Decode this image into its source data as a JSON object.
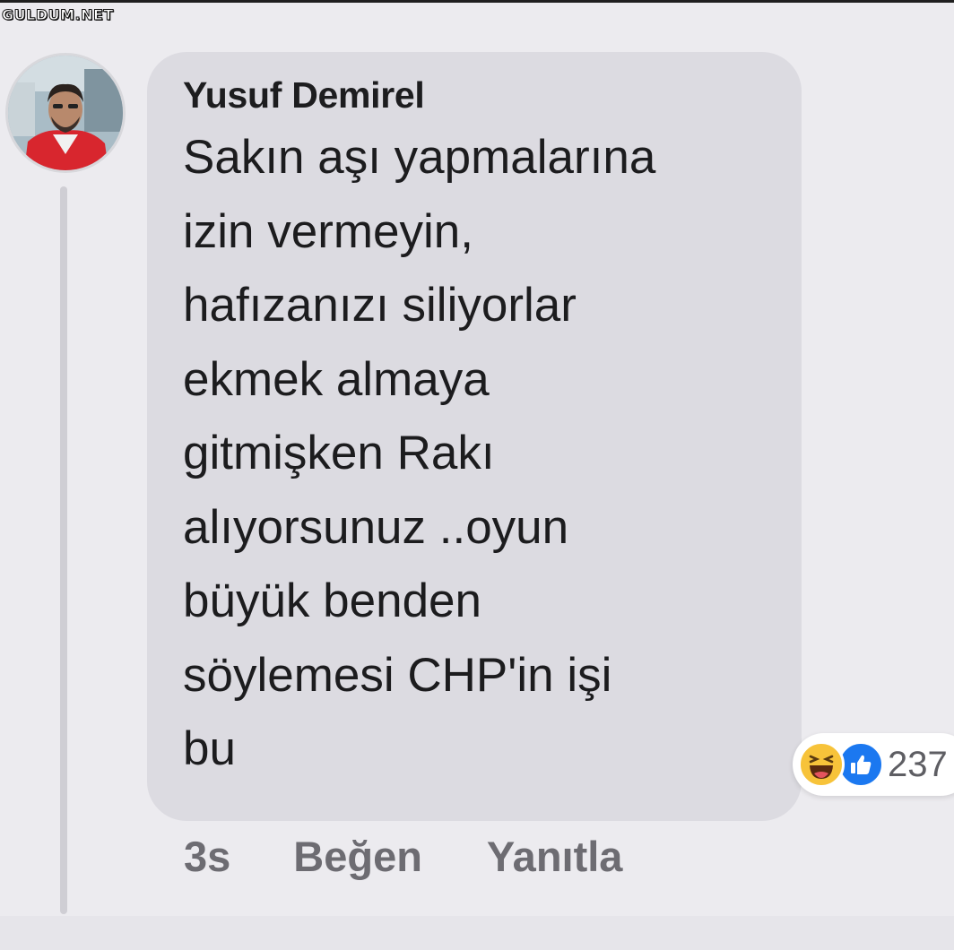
{
  "watermark": "GULDUM.NET",
  "comment": {
    "author": "Yusuf Demirel",
    "text_lines": [
      "Sakın aşı yapmalarına",
      "izin vermeyin,",
      "hafızanızı siliyorlar",
      "ekmek almaya",
      "gitmişken Rakı",
      "alıyorsunuz ..oyun",
      "büyük benden",
      "söylemesi CHP'in işi",
      "bu"
    ],
    "reactions": {
      "icons": [
        "haha-icon",
        "like-icon"
      ],
      "count": "237"
    },
    "actions": {
      "time": "3s",
      "like_label": "Beğen",
      "reply_label": "Yanıtla"
    }
  },
  "colors": {
    "background": "#ecebef",
    "bubble": "#dcdbe1",
    "like_blue": "#1b78f0",
    "haha_yellow": "#f7c33a"
  }
}
